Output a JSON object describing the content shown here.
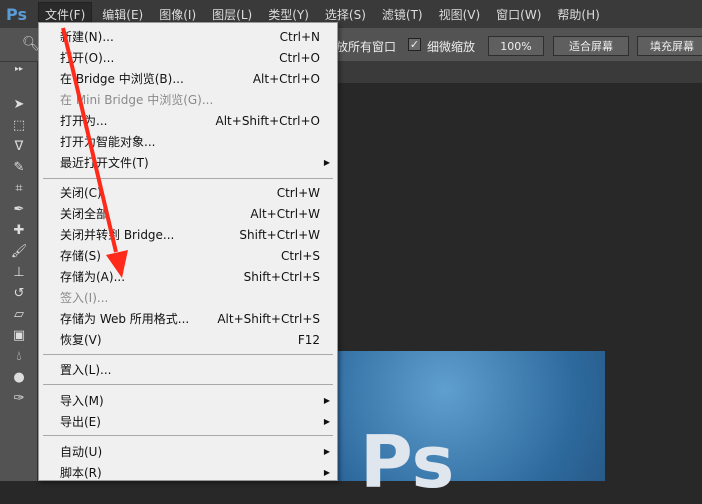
{
  "app": {
    "logo": "Ps"
  },
  "menubar": [
    "文件(F)",
    "编辑(E)",
    "图像(I)",
    "图层(L)",
    "类型(Y)",
    "选择(S)",
    "滤镜(T)",
    "视图(V)",
    "窗口(W)",
    "帮助(H)"
  ],
  "options": {
    "partial_label": "放所有窗口",
    "scrubby_zoom": "细微缩放",
    "scrubby_checked": true,
    "zoom_100": "100%",
    "fit_screen": "适合屏幕",
    "fill_screen": "填充屏幕"
  },
  "file_menu": [
    {
      "label": "新建(N)...",
      "shortcut": "Ctrl+N"
    },
    {
      "label": "打开(O)...",
      "shortcut": "Ctrl+O"
    },
    {
      "label": "在 Bridge 中浏览(B)...",
      "shortcut": "Alt+Ctrl+O"
    },
    {
      "label": "在 Mini Bridge 中浏览(G)...",
      "shortcut": "",
      "disabled": true
    },
    {
      "label": "打开为...",
      "shortcut": "Alt+Shift+Ctrl+O"
    },
    {
      "label": "打开为智能对象...",
      "shortcut": ""
    },
    {
      "label": "最近打开文件(T)",
      "shortcut": "",
      "submenu": true
    },
    {
      "label": "关闭(C)",
      "shortcut": "Ctrl+W"
    },
    {
      "label": "关闭全部",
      "shortcut": "Alt+Ctrl+W"
    },
    {
      "label": "关闭并转到 Bridge...",
      "shortcut": "Shift+Ctrl+W"
    },
    {
      "label": "存储(S)",
      "shortcut": "Ctrl+S"
    },
    {
      "label": "存储为(A)...",
      "shortcut": "Shift+Ctrl+S"
    },
    {
      "label": "签入(I)...",
      "shortcut": "",
      "disabled": true
    },
    {
      "label": "存储为 Web 所用格式...",
      "shortcut": "Alt+Shift+Ctrl+S"
    },
    {
      "label": "恢复(V)",
      "shortcut": "F12"
    },
    {
      "label": "置入(L)...",
      "shortcut": ""
    },
    {
      "label": "导入(M)",
      "shortcut": "",
      "submenu": true
    },
    {
      "label": "导出(E)",
      "shortcut": "",
      "submenu": true
    },
    {
      "label": "自动(U)",
      "shortcut": "",
      "submenu": true
    },
    {
      "label": "脚本(R)",
      "shortcut": "",
      "submenu": true
    }
  ],
  "colors": {
    "annotation_arrow": "#ff2a1a"
  }
}
